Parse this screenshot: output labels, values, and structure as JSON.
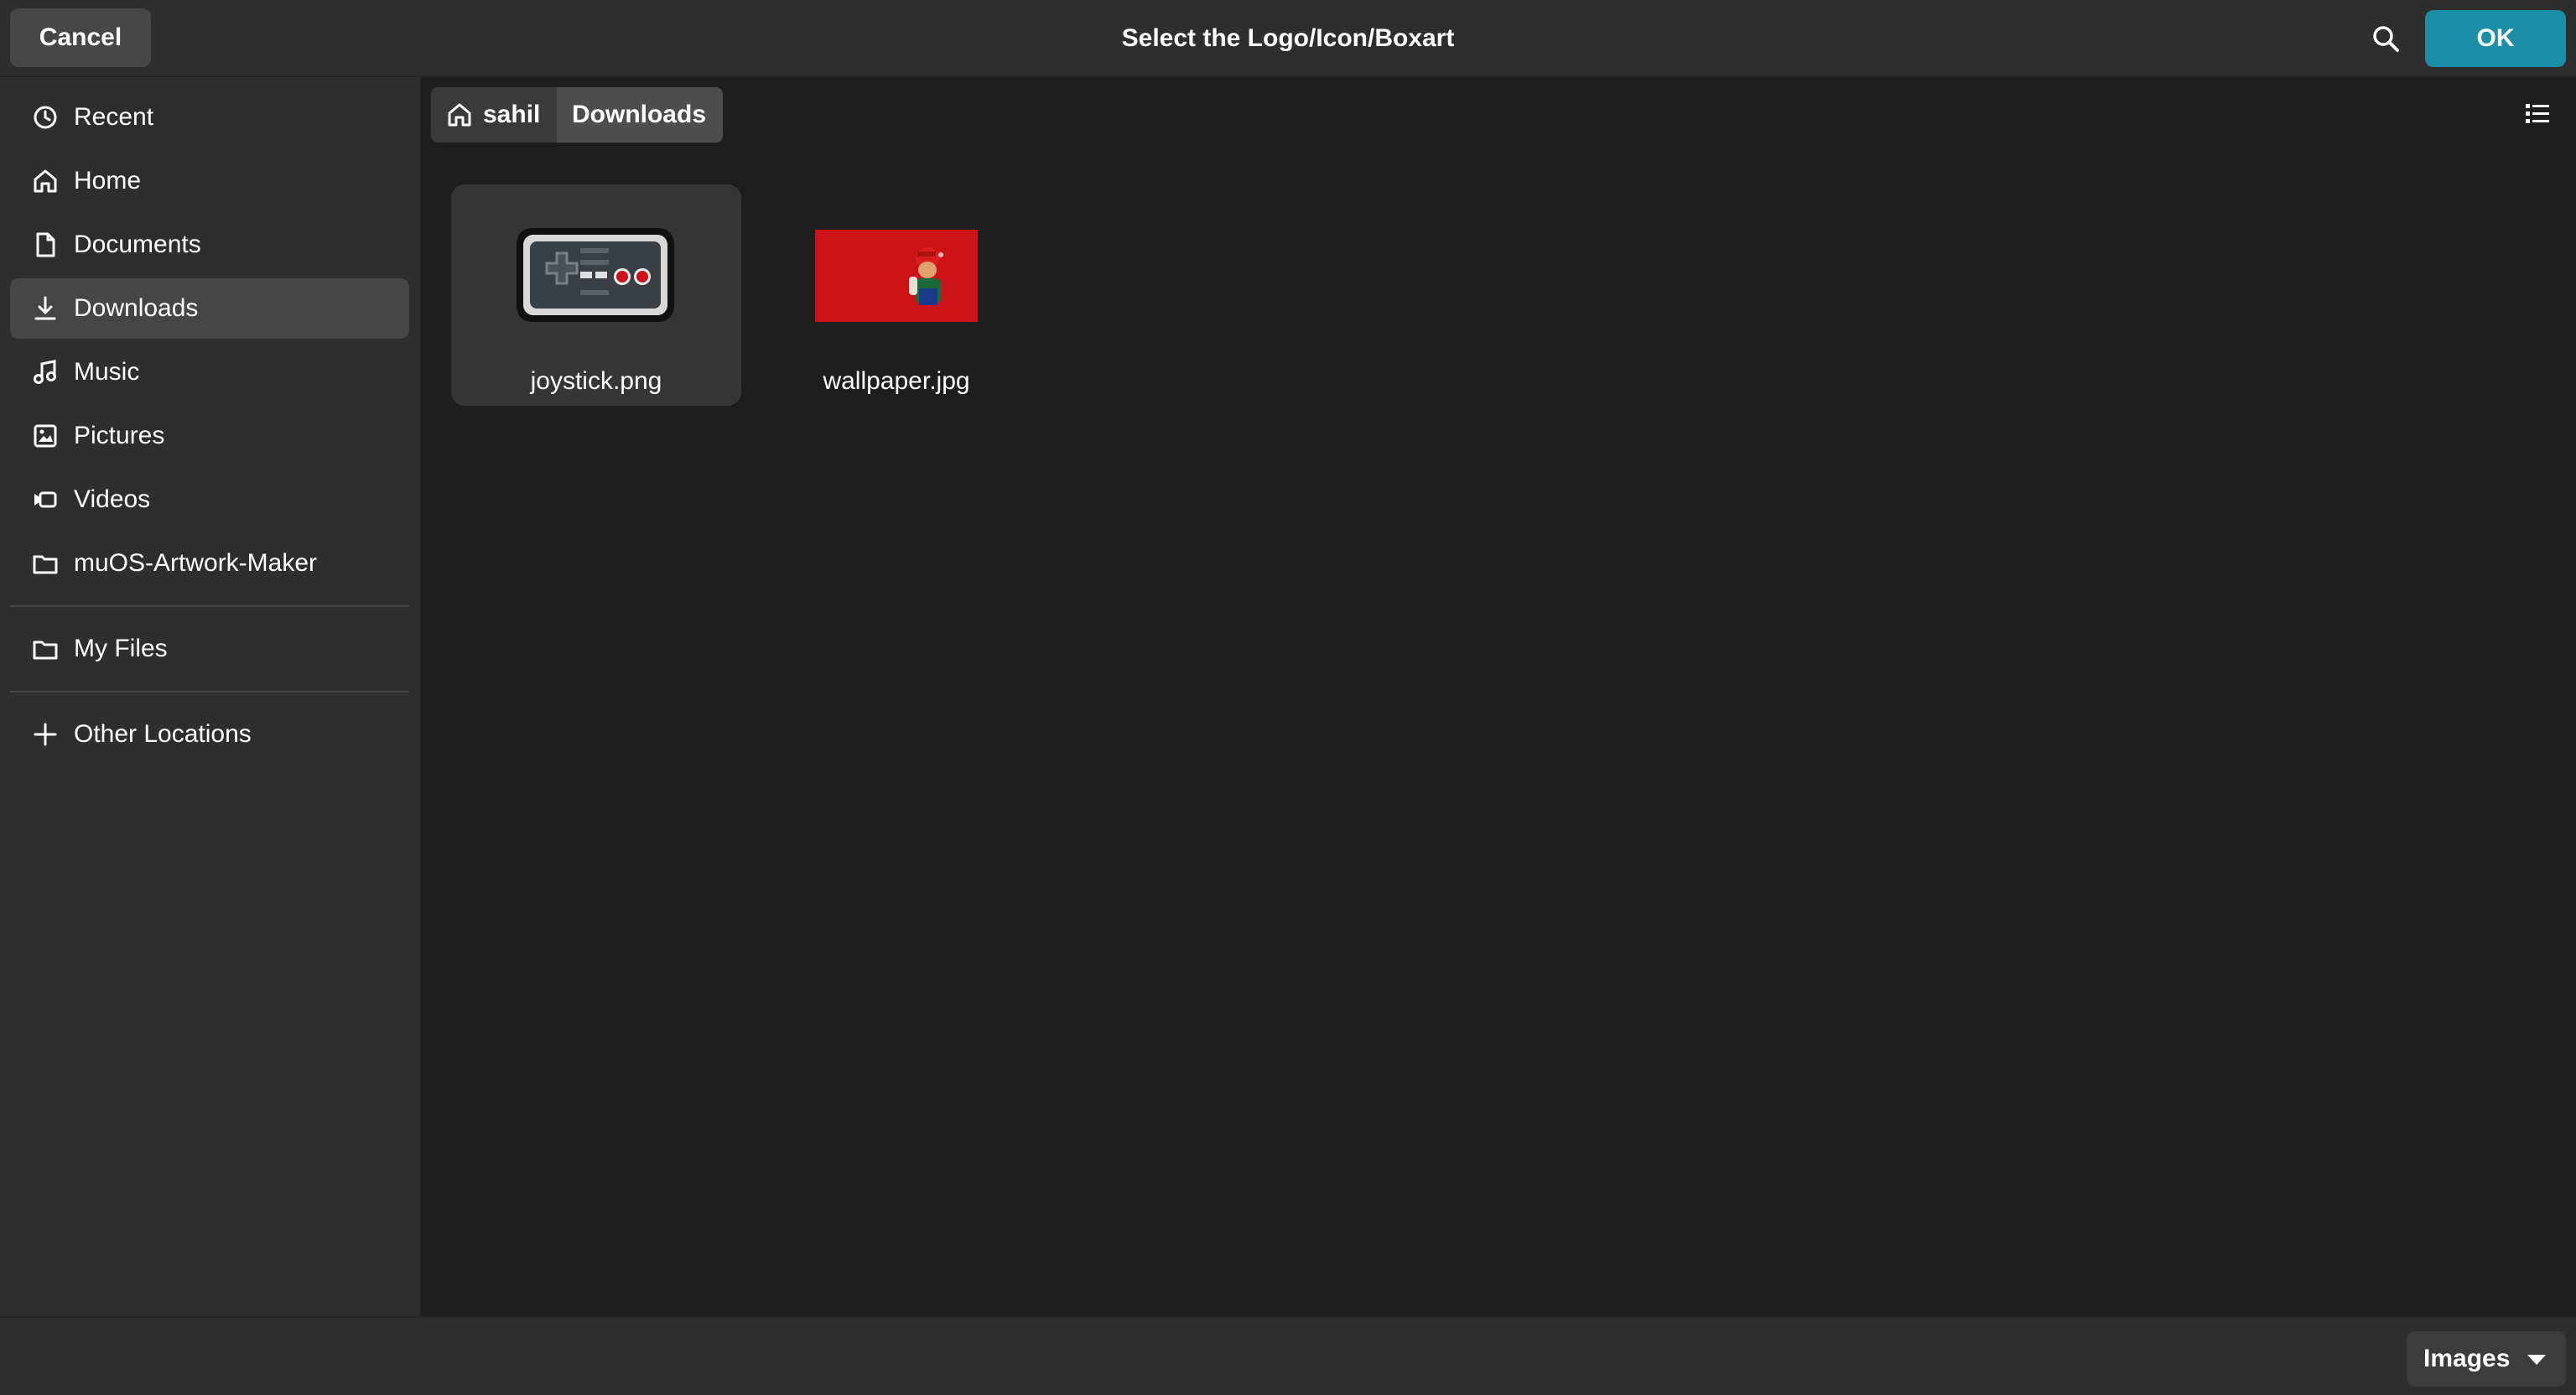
{
  "dialog": {
    "title": "Select the Logo/Icon/Boxart",
    "cancel_label": "Cancel",
    "ok_label": "OK",
    "accent_color": "#1c8ea6"
  },
  "sidebar": {
    "items": [
      {
        "label": "Recent",
        "icon": "clock-icon"
      },
      {
        "label": "Home",
        "icon": "home-icon"
      },
      {
        "label": "Documents",
        "icon": "document-icon"
      },
      {
        "label": "Downloads",
        "icon": "download-icon",
        "active": true
      },
      {
        "label": "Music",
        "icon": "music-icon"
      },
      {
        "label": "Pictures",
        "icon": "picture-icon"
      },
      {
        "label": "Videos",
        "icon": "video-icon"
      },
      {
        "label": "muOS-Artwork-Maker",
        "icon": "folder-icon"
      }
    ],
    "my_files": {
      "label": "My Files",
      "icon": "folder-icon"
    },
    "other_locations": {
      "label": "Other Locations",
      "icon": "plus-icon"
    }
  },
  "pathbar": {
    "home": "sahil",
    "current": "Downloads"
  },
  "files": [
    {
      "name": "joystick.png",
      "selected": true
    },
    {
      "name": "wallpaper.jpg",
      "selected": false
    }
  ],
  "footer": {
    "filter_label": "Images"
  }
}
